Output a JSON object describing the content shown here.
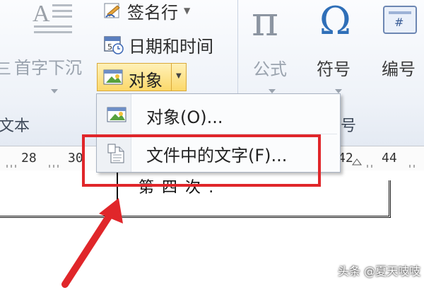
{
  "ribbon": {
    "signature_line_label": "签名行",
    "datetime_label": "日期和时间",
    "dropcap_label": "首字下沉",
    "object_button_label": "对象",
    "formula_label": "公式",
    "symbol_label": "符号",
    "number_label": "编号",
    "text_group_label": "文本",
    "symbol_group_label": "号",
    "pi_glyph": "π",
    "omega_glyph": "Ω",
    "number_glyph": "#"
  },
  "menu": {
    "items": [
      {
        "label": "对象(O)...",
        "icon": "object-icon"
      },
      {
        "label": "文件中的文字(F)...",
        "icon": "file-text-icon"
      }
    ]
  },
  "ruler": {
    "ticks": [
      "28",
      "30",
      "42",
      "44"
    ]
  },
  "document": {
    "visible_text": "第 四 次 :"
  },
  "watermark": "头条 @夏天吱吱",
  "colors": {
    "highlight": "#e0262a",
    "object_button_bg": "#fbe08a"
  }
}
